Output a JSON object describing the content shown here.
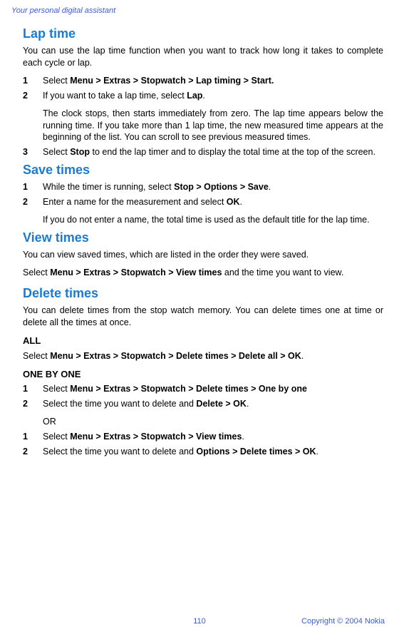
{
  "header": "Your personal digital assistant",
  "sections": {
    "lapTime": {
      "title": "Lap time",
      "intro": "You can use the lap time function when you want to track how long it takes to complete each cycle or lap.",
      "step1_prefix": "Select ",
      "step1_bold": "Menu > Extras > Stopwatch > Lap timing > Start.",
      "step2_prefix": "If you want to take a lap time, select ",
      "step2_bold": "Lap",
      "step2_suffix": ".",
      "step2_para2": "The clock stops, then starts immediately from zero. The lap time appears below the running time. If you take more than 1 lap time, the new measured time appears at the beginning of the list. You can scroll to see previous measured times.",
      "step3_prefix": "Select ",
      "step3_bold": "Stop",
      "step3_suffix": " to end the lap timer and to display the total time at the top of the screen."
    },
    "saveTimes": {
      "title": "Save times",
      "step1_prefix": "While the timer is running, select ",
      "step1_bold": "Stop > Options > Save",
      "step1_suffix": ".",
      "step2_prefix": "Enter a name for the measurement and select ",
      "step2_bold": "OK",
      "step2_suffix": ".",
      "step2_para2": "If you do not enter a name, the total time is used as the default title for the lap time."
    },
    "viewTimes": {
      "title": "View times",
      "intro": "You can view saved times, which are listed in the order they were saved.",
      "select_prefix": "Select ",
      "select_bold": "Menu > Extras > Stopwatch > View times",
      "select_suffix": " and the time you want to view."
    },
    "deleteTimes": {
      "title": "Delete times",
      "intro": "You can delete times from the stop watch memory. You can delete times one at time or delete all the times at once.",
      "all_heading": "ALL",
      "all_prefix": "Select ",
      "all_bold": "Menu > Extras > Stopwatch > Delete times > Delete all > OK",
      "all_suffix": ".",
      "one_heading": "ONE BY ONE",
      "one_step1_prefix": "Select ",
      "one_step1_bold": "Menu > Extras > Stopwatch > Delete times > One by one",
      "one_step2_prefix": "Select the time you want to delete and ",
      "one_step2_bold": "Delete > OK",
      "one_step2_suffix": ".",
      "or": "OR",
      "alt_step1_prefix": "Select ",
      "alt_step1_bold": "Menu > Extras > Stopwatch > View times",
      "alt_step1_suffix": ".",
      "alt_step2_prefix": "Select the time you want to delete and ",
      "alt_step2_bold": "Options > Delete times > OK",
      "alt_step2_suffix": "."
    }
  },
  "nums": {
    "n1": "1",
    "n2": "2",
    "n3": "3"
  },
  "footer": {
    "page": "110",
    "copyright": "Copyright © 2004 Nokia"
  }
}
